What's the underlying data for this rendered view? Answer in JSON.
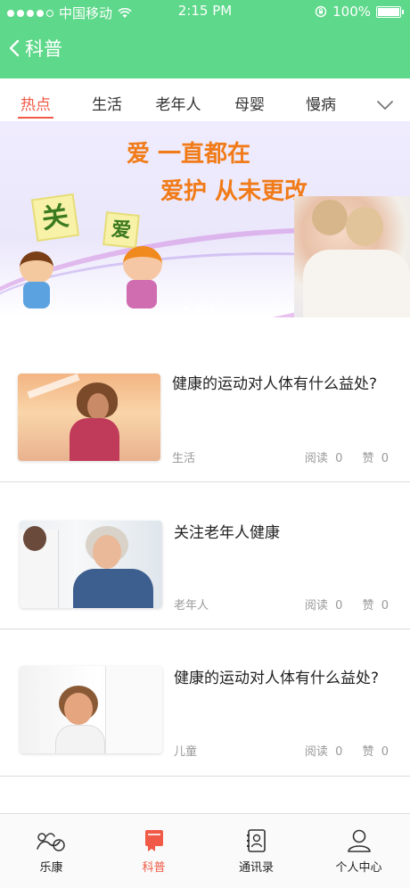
{
  "status_bar": {
    "carrier": "中国移动",
    "time": "2:15 PM",
    "battery": "100%"
  },
  "header": {
    "title": "科普"
  },
  "tabs": [
    {
      "label": "热点",
      "active": true
    },
    {
      "label": "生活",
      "active": false
    },
    {
      "label": "老年人",
      "active": false
    },
    {
      "label": "母婴",
      "active": false
    },
    {
      "label": "慢病",
      "active": false
    }
  ],
  "banner": {
    "line1": "爱  一直都在",
    "line2": "爱护  从未更改",
    "sign1": "关",
    "sign2": "爱",
    "pages": 3,
    "current_page": 1
  },
  "articles": [
    {
      "title": "健康的运动对人体有什么益处?",
      "category": "生活",
      "read_label": "阅读",
      "read_count": "0",
      "like_label": "赞",
      "like_count": "0"
    },
    {
      "title": "关注老年人健康",
      "category": "老年人",
      "read_label": "阅读",
      "read_count": "0",
      "like_label": "赞",
      "like_count": "0"
    },
    {
      "title": "健康的运动对人体有什么益处?",
      "category": "儿童",
      "read_label": "阅读",
      "read_count": "0",
      "like_label": "赞",
      "like_count": "0"
    }
  ],
  "tabbar": [
    {
      "label": "乐康",
      "icon": "lekang-logo-icon",
      "active": false
    },
    {
      "label": "科普",
      "icon": "book-icon",
      "active": true
    },
    {
      "label": "通讯录",
      "icon": "contacts-icon",
      "active": false
    },
    {
      "label": "个人中心",
      "icon": "person-icon",
      "active": false
    }
  ],
  "colors": {
    "header_green": "#5ed88a",
    "accent_red": "#f05a47",
    "banner_text_orange": "#f07b18"
  }
}
